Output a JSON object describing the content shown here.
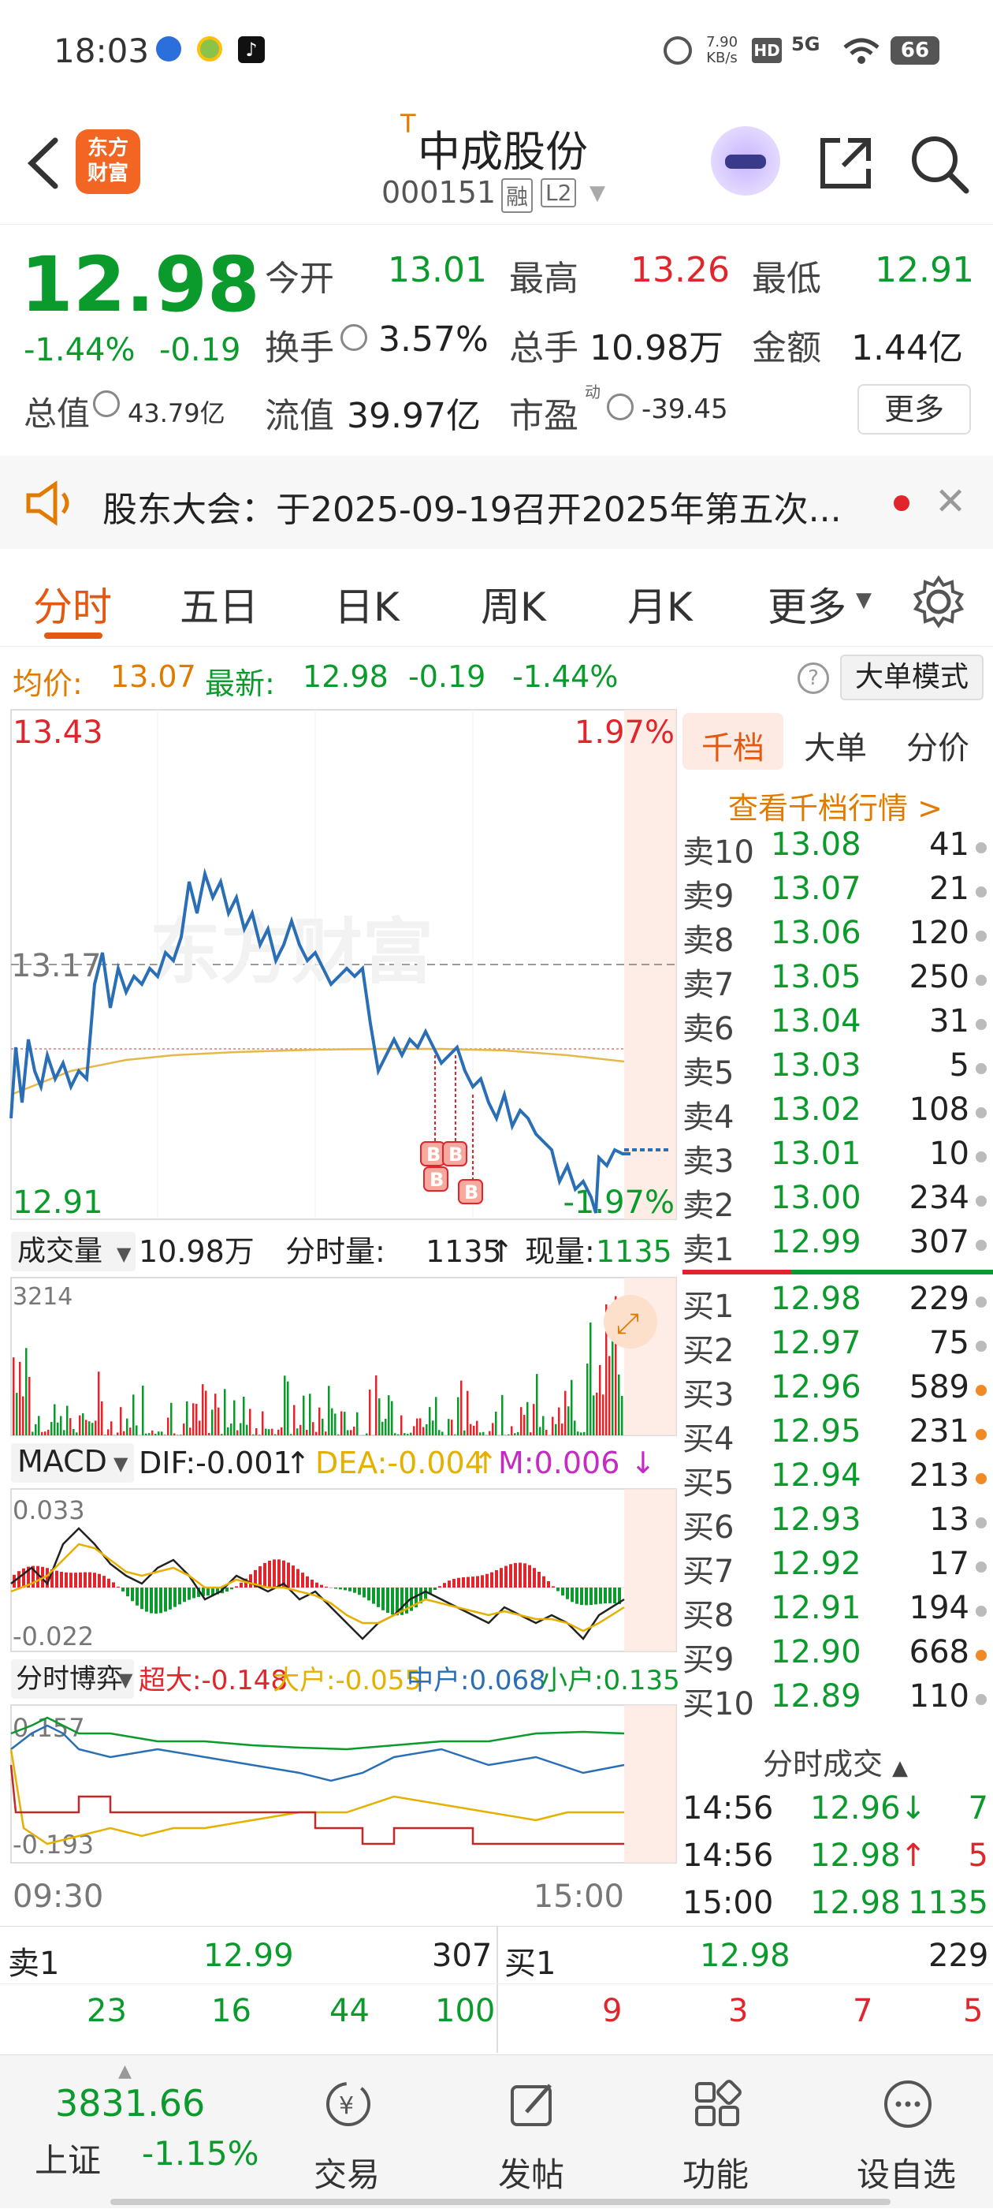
{
  "status_bar": {
    "time": "18:03",
    "net_speed_value": "7.90",
    "net_speed_unit": "KB/s",
    "hd": "HD",
    "signal": "5G",
    "battery": "66"
  },
  "header": {
    "logo_line1": "东方",
    "logo_line2": "财富",
    "tag": "T",
    "title": "中成股份",
    "code": "000151",
    "badge_rong": "融",
    "badge_l2": "L2"
  },
  "quote": {
    "price": "12.98",
    "change_pct": "-1.44%",
    "change": "-0.19",
    "open_label": "今开",
    "open": "13.01",
    "high_label": "最高",
    "high": "13.26",
    "low_label": "最低",
    "low": "12.91",
    "turnover_label": "换手",
    "turnover": "3.57%",
    "volume_label": "总手",
    "volume": "10.98万",
    "amount_label": "金额",
    "amount": "1.44亿",
    "mktcap_label": "总值",
    "mktcap": "43.79亿",
    "float_label": "流值",
    "float": "39.97亿",
    "pe_label": "市盈",
    "pe_sup": "动",
    "pe": "-39.45",
    "more_button": "更多"
  },
  "notice": {
    "text": "股东大会：于2025-09-19召开2025年第五次..."
  },
  "tabs": [
    "分时",
    "五日",
    "日K",
    "周K",
    "月K",
    "更多"
  ],
  "info_line": {
    "avg_label": "均价:",
    "avg": "13.07",
    "latest_label": "最新:",
    "latest": "12.98",
    "chg": "-0.19",
    "pct": "-1.44%",
    "mode_button": "大单模式"
  },
  "chart": {
    "top_price": "13.43",
    "top_pct": "1.97%",
    "mid_price": "13.17",
    "low_price": "12.91",
    "low_pct": "-1.97%",
    "watermark": "东方财富",
    "vol_label": "成交量",
    "vol_total": "10.98万",
    "fenshi_label": "分时量:",
    "fenshi_val": "1135",
    "xian_label": "现量:",
    "xian_val": "1135",
    "vol_max": "3214",
    "macd_label": "MACD",
    "dif": "DIF:-0.001",
    "dea": "DEA:-0.004",
    "m": "M:0.006",
    "macd_top": "0.033",
    "macd_bot": "-0.022",
    "bo_label": "分时博弈",
    "chaoda": "超大:-0.148",
    "dahu": "大户:-0.055",
    "zhonghu": "中户:0.068",
    "xiaohu": "小户:0.135",
    "bo_top": "0.157",
    "bo_bot": "-0.193",
    "time_start": "09:30",
    "time_end": "15:00"
  },
  "chart_data": {
    "type": "line",
    "title": "",
    "ylim": [
      12.91,
      13.43
    ],
    "x_start": "09:30",
    "x_end": "15:00",
    "ref_price": "13.17",
    "series": []
  },
  "orderbook": {
    "tabs": [
      "千档",
      "大单",
      "分价"
    ],
    "link": "查看千档行情 >",
    "asks": [
      {
        "l": "卖10",
        "p": "13.08",
        "v": "41"
      },
      {
        "l": "卖9",
        "p": "13.07",
        "v": "21"
      },
      {
        "l": "卖8",
        "p": "13.06",
        "v": "120"
      },
      {
        "l": "卖7",
        "p": "13.05",
        "v": "250"
      },
      {
        "l": "卖6",
        "p": "13.04",
        "v": "31"
      },
      {
        "l": "卖5",
        "p": "13.03",
        "v": "5"
      },
      {
        "l": "卖4",
        "p": "13.02",
        "v": "108"
      },
      {
        "l": "卖3",
        "p": "13.01",
        "v": "10"
      },
      {
        "l": "卖2",
        "p": "13.00",
        "v": "234"
      },
      {
        "l": "卖1",
        "p": "12.99",
        "v": "307"
      }
    ],
    "bids": [
      {
        "l": "买1",
        "p": "12.98",
        "v": "229"
      },
      {
        "l": "买2",
        "p": "12.97",
        "v": "75"
      },
      {
        "l": "买3",
        "p": "12.96",
        "v": "589"
      },
      {
        "l": "买4",
        "p": "12.95",
        "v": "231"
      },
      {
        "l": "买5",
        "p": "12.94",
        "v": "213"
      },
      {
        "l": "买6",
        "p": "12.93",
        "v": "13"
      },
      {
        "l": "买7",
        "p": "12.92",
        "v": "17"
      },
      {
        "l": "买8",
        "p": "12.91",
        "v": "194"
      },
      {
        "l": "买9",
        "p": "12.90",
        "v": "668"
      },
      {
        "l": "买10",
        "p": "12.89",
        "v": "110"
      }
    ],
    "trades_title": "分时成交",
    "trades": [
      {
        "t": "14:56",
        "p": "12.96",
        "a": "↓",
        "v": "7"
      },
      {
        "t": "14:56",
        "p": "12.98",
        "a": "↑",
        "v": "5"
      },
      {
        "t": "15:00",
        "p": "12.98",
        "a": "",
        "v": "1135"
      }
    ]
  },
  "bottom_table": {
    "sell_label": "卖1",
    "sell_price": "12.99",
    "sell_vol": "307",
    "buy_label": "买1",
    "buy_price": "12.98",
    "buy_vol": "229",
    "sell_nums": [
      "23",
      "16",
      "44",
      "100"
    ],
    "buy_nums": [
      "9",
      "3",
      "7",
      "5"
    ]
  },
  "bottom_nav": {
    "index_value": "3831.66",
    "index_name": "上证",
    "index_pct": "-1.15%",
    "items": [
      "交易",
      "发帖",
      "功能",
      "设自选"
    ]
  }
}
